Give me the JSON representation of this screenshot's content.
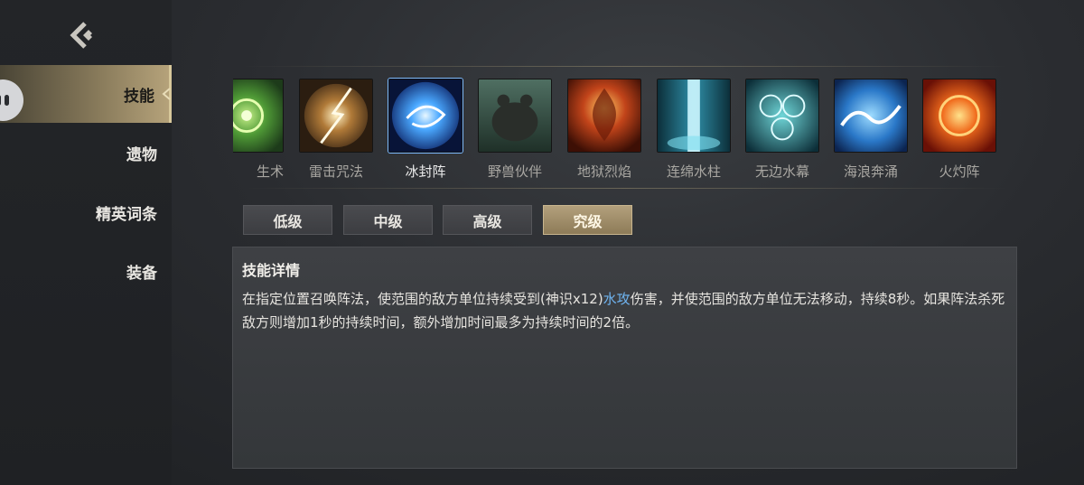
{
  "sidebar": {
    "items": [
      {
        "label": "技能",
        "active": true
      },
      {
        "label": "遗物",
        "active": false
      },
      {
        "label": "精英词条",
        "active": false
      },
      {
        "label": "装备",
        "active": false
      }
    ]
  },
  "skills": [
    {
      "label": "生术",
      "icon": "green-nature-rune-icon",
      "selected": false
    },
    {
      "label": "雷击咒法",
      "icon": "lightning-orb-icon",
      "selected": false
    },
    {
      "label": "冰封阵",
      "icon": "ice-vortex-icon",
      "selected": true
    },
    {
      "label": "野兽伙伴",
      "icon": "bear-companion-icon",
      "selected": false
    },
    {
      "label": "地狱烈焰",
      "icon": "hellfire-demon-icon",
      "selected": false
    },
    {
      "label": "连绵水柱",
      "icon": "water-pillar-icon",
      "selected": false
    },
    {
      "label": "无边水幕",
      "icon": "water-curtain-orbs-icon",
      "selected": false
    },
    {
      "label": "海浪奔涌",
      "icon": "ocean-wave-icon",
      "selected": false
    },
    {
      "label": "火灼阵",
      "icon": "fire-circle-icon",
      "selected": false
    }
  ],
  "tiers": [
    {
      "label": "低级",
      "active": false
    },
    {
      "label": "中级",
      "active": false
    },
    {
      "label": "高级",
      "active": false
    },
    {
      "label": "究级",
      "active": true
    }
  ],
  "detail": {
    "title": "技能详情",
    "text_before": "在指定位置召唤阵法，使范围的敌方单位持续受到(神识x12)",
    "highlight": "水攻",
    "text_after": "伤害，并使范围的敌方单位无法移动，持续8秒。如果阵法杀死敌方则增加1秒的持续时间，额外增加时间最多为持续时间的2倍。"
  },
  "colors": {
    "accent_gold": "#b3a07c",
    "highlight_blue": "#6fb5f2",
    "panel_bg": "#3e4044"
  }
}
